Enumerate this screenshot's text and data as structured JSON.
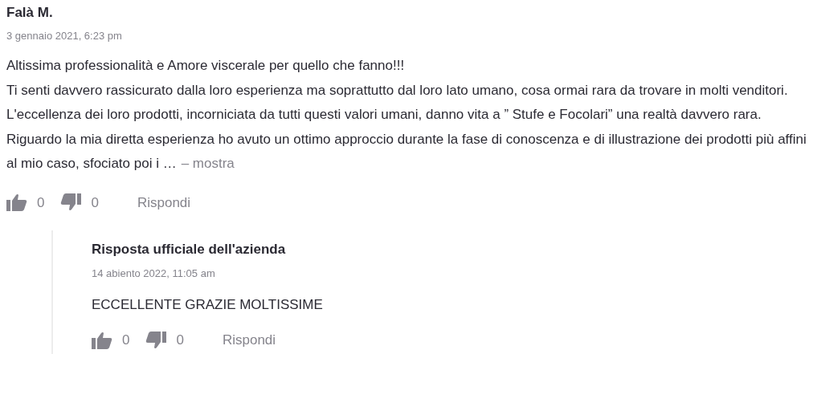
{
  "review": {
    "author": "Falà M.",
    "date": "3 gennaio 2021, 6:23 pm",
    "paragraphs": [
      "Altissima professionalità e Amore viscerale per quello che fanno!!!",
      "Ti senti davvero rassicurato dalla loro esperienza ma soprattutto dal loro lato umano, cosa ormai rara da trovare in molti venditori.",
      "L'eccellenza dei loro prodotti, incorniciata da tutti questi valori umani, danno vita a ” Stufe e Focolari” una realtà davvero rara.",
      "Riguardo la mia diretta esperienza ho avuto un ottimo approccio durante la fase di conoscenza e di illustrazione dei prodotti più affini al mio caso, sfociato poi i …"
    ],
    "more_link": "– mostra",
    "likes": "0",
    "dislikes": "0",
    "reply_label": "Rispondi"
  },
  "reply": {
    "author": "Risposta ufficiale dell'azienda",
    "date": "14 abiento 2022, 11:05 am",
    "paragraphs": [
      "ECCELLENTE GRAZIE MOLTISSIME"
    ],
    "likes": "0",
    "dislikes": "0",
    "reply_label": "Rispondi"
  }
}
